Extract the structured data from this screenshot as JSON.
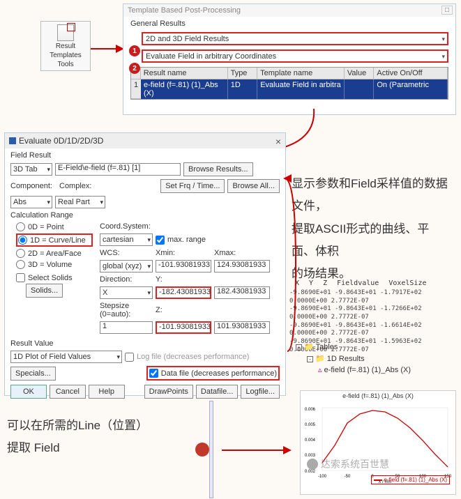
{
  "tool": {
    "line1": "Result",
    "line2": "Templates",
    "line3": "Tools"
  },
  "win1": {
    "title": "Template Based Post-Processing",
    "section": "General Results",
    "dd1": "2D and 3D Field Results",
    "dd2": "Evaluate Field in arbitrary Coordinates",
    "headers": {
      "name": "Result name",
      "type": "Type",
      "tpl": "Template name",
      "val": "Value",
      "act": "Active On/Off"
    },
    "row": {
      "idx": "1",
      "name": "e-field (f=.81) (1)_Abs (X)",
      "type": "1D",
      "tpl": "Evaluate Field in arbitra",
      "val": "",
      "act": "On (Parametric"
    }
  },
  "win2": {
    "title": "Evaluate 0D/1D/2D/3D",
    "close": "×",
    "field_result": "Field Result",
    "tab3d": "3D Tab",
    "field_path": "E-Field\\e-field (f=.81) [1]",
    "browse_results": "Browse Results...",
    "component": "Component:",
    "complex": "Complex:",
    "abs": "Abs",
    "realpart": "Real Part",
    "setfrq": "Set Frq / Time...",
    "browseall": "Browse All...",
    "calc_range": "Calculation Range",
    "r0": "0D = Point",
    "r1": "1D = Curve/Line",
    "r2": "2D = Area/Face",
    "r3": "3D = Volume",
    "select_solids": "Select Solids",
    "solids_btn": "Solids...",
    "coord_sys": "Coord.System:",
    "cartesian": "cartesian",
    "wcs": "WCS:",
    "globalxyz": "global (xyz)",
    "direction": "Direction:",
    "dirX": "X",
    "stepsize": "Stepsize (0=auto):",
    "step_val": "1",
    "max_range": "max. range",
    "xmin": "Xmin:",
    "xmin_v": "-101.93081933",
    "xmax": "Xmax:",
    "xmax_v": "124.93081933",
    "y": "Y:",
    "y_v": "-182.43081933",
    "y_v2": "182.43081933",
    "z": "Z:",
    "z_v": "-101.93081933",
    "z_v2": "101.93081933",
    "result_value": "Result Value",
    "plot1d": "1D Plot of Field Values",
    "specials": "Specials...",
    "logfile": "Log file (decreases performance)",
    "datafile": "Data file (decreases performance)",
    "ok": "OK",
    "cancel": "Cancel",
    "help": "Help",
    "drawpts": "DrawPoints",
    "datafile_btn": "Datafile...",
    "logfile_btn": "Logfile..."
  },
  "anno1": {
    "l1": "显示参数和Field采样值的数据文件，",
    "l2": "提取ASCII形式的曲线、平面、体积",
    "l3": "的场结果。"
  },
  "anno2": {
    "l1": "可以在所需的Line（位置）",
    "l2": "提取 Field"
  },
  "data_hdr": {
    "x": "X",
    "y": "Y",
    "z": "Z",
    "fv": "Fieldvalue",
    "vs": "VoxelSize"
  },
  "data_rows": [
    "-9.8690E+01 -9.8643E+01 -1.7917E+02  0.0000E+00  2.7772E-07",
    "-9.8690E+01 -9.8643E+01 -1.7266E+02  0.0000E+00  2.7772E-07",
    "-9.8690E+01 -9.8643E+01 -1.6614E+02  0.0000E+00  2.7772E-07",
    "-9.8690E+01 -9.8643E+01 -1.5963E+02  0.0000E+00  2.7772E-07"
  ],
  "tree": {
    "tables": "Tables",
    "results1d": "1D Results",
    "item": "e-field (f=.81) (1)_Abs (X)"
  },
  "chart_data": {
    "type": "line",
    "title": "e-field (f=.81) (1)_Abs (X)",
    "xlabel": "X / mm",
    "ylabel": "",
    "xlim": [
      -100,
      150
    ],
    "ylim": [
      0.002,
      0.006
    ],
    "xticks": [
      -100,
      -50,
      0,
      50,
      100,
      150
    ],
    "yticks": [
      0.002,
      0.0025,
      0.003,
      0.0035,
      0.004,
      0.0045,
      0.005,
      0.0055,
      0.006
    ],
    "series": [
      {
        "name": "e-field (f=.81) (1)_Abs (X)",
        "color": "#c00",
        "x": [
          -100,
          -75,
          -50,
          -25,
          0,
          25,
          50,
          75,
          100,
          125,
          150
        ],
        "values": [
          0.0025,
          0.0036,
          0.005,
          0.0056,
          0.0058,
          0.0057,
          0.0053,
          0.0047,
          0.0039,
          0.003,
          0.0022
        ]
      }
    ]
  },
  "watermark": "达索系统百世慧"
}
